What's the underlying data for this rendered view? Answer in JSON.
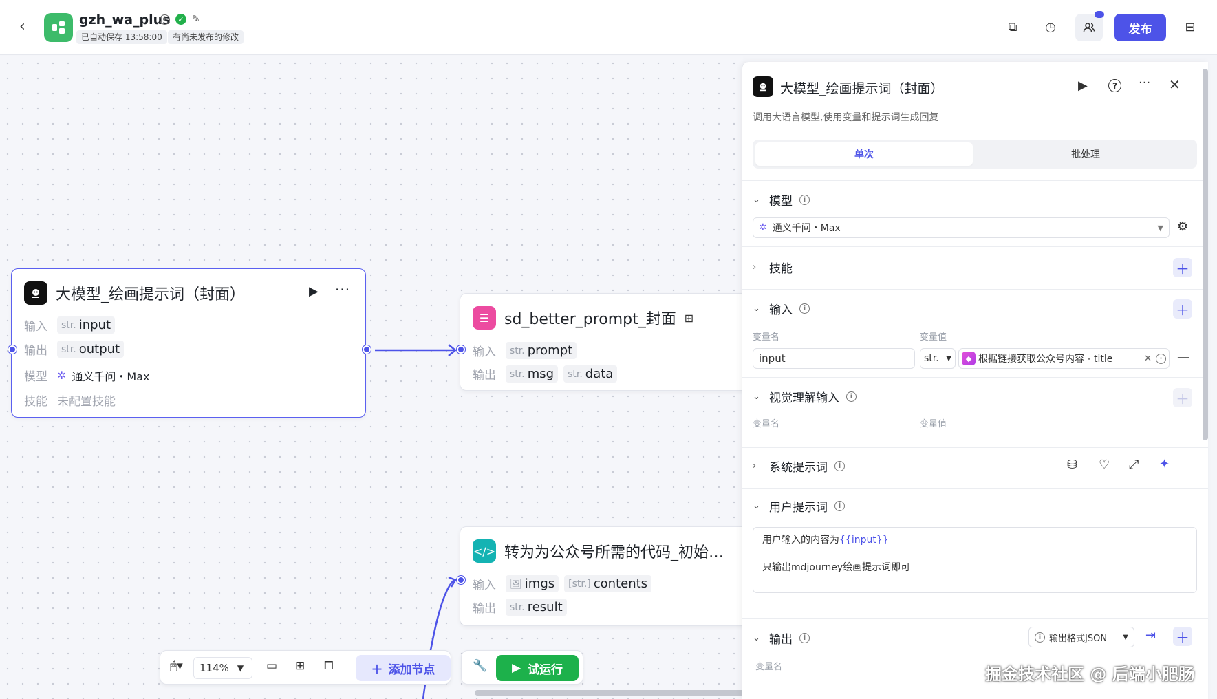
{
  "header": {
    "back": "‹",
    "app_name": "gzh_wa_plus",
    "autosave": "已自动保存 13:58:00",
    "unpublished": "有尚未发布的修改",
    "publish_label": "发布"
  },
  "nodes": {
    "llm": {
      "title": "大模型_绘画提示词（封面）",
      "input_label": "输入",
      "input_type": "str.",
      "input_name": "input",
      "output_label": "输出",
      "output_type": "str.",
      "output_name": "output",
      "model_label": "模型",
      "model_name": "通义千问・Max",
      "skill_label": "技能",
      "skill_value": "未配置技能"
    },
    "sd": {
      "title": "sd_better_prompt_封面",
      "input_label": "输入",
      "input_type": "str.",
      "input_name": "prompt",
      "output_label": "输出",
      "out1_type": "str.",
      "out1_name": "msg",
      "out2_type": "str.",
      "out2_name": "data"
    },
    "code": {
      "title": "转为为公众号所需的代码_初始…",
      "input_label": "输入",
      "in1_name": "imgs",
      "in2_type": "[str.]",
      "in2_name": "contents",
      "output_label": "输出",
      "out_type": "str.",
      "out_name": "result"
    }
  },
  "toolbar": {
    "zoom": "114%",
    "add_node": "添加节点",
    "run": "试运行"
  },
  "panel": {
    "title": "大模型_绘画提示词（封面）",
    "description": "调用大语言模型,使用变量和提示词生成回复",
    "tabs": [
      "单次",
      "批处理"
    ],
    "model_section": "模型",
    "model_value": "通义千问・Max",
    "skills_section": "技能",
    "input_section": "输入",
    "var_name_col": "变量名",
    "var_value_col": "变量值",
    "input_var_name": "input",
    "input_var_type": "str.",
    "input_ref": "根据链接获取公众号内容 - title",
    "vision_section": "视觉理解输入",
    "vision_name_col": "变量名",
    "vision_value_col": "变量值",
    "system_prompt_section": "系统提示词",
    "user_prompt_section": "用户提示词",
    "user_prompt_line1_prefix": "用户输入的内容为",
    "user_prompt_line1_var": "{{input}}",
    "user_prompt_line2": "只输出mdjourney绘画提示词即可",
    "output_section": "输出",
    "output_format": "输出格式JSON",
    "output_name_col": "变量名"
  },
  "watermark": "掘金技术社区 @ 后端小肥肠"
}
